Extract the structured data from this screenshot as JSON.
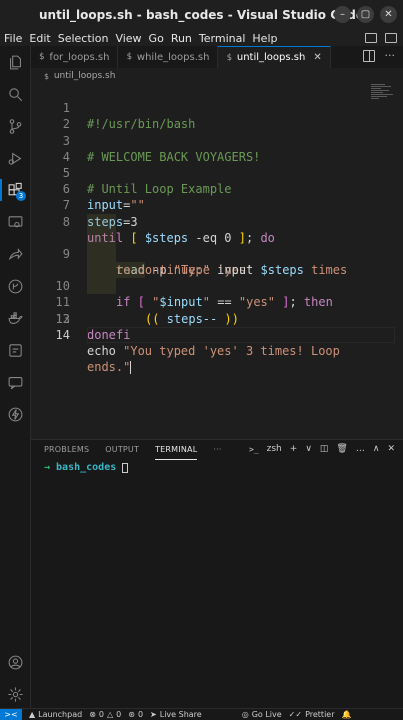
{
  "window": {
    "title": "until_loops.sh - bash_codes - Visual Studio Code",
    "controls": [
      "–",
      "▢",
      "✕"
    ]
  },
  "menu": [
    "File",
    "Edit",
    "Selection",
    "View",
    "Go",
    "Run",
    "Terminal",
    "Help"
  ],
  "activity": {
    "extensions_badge": "3"
  },
  "tabs": [
    {
      "label": "for_loops.sh",
      "icon": "$"
    },
    {
      "label": "while_loops.sh",
      "icon": "$"
    },
    {
      "label": "until_loops.sh",
      "icon": "$",
      "close": "✕"
    }
  ],
  "breadcrumb": {
    "icon": "$",
    "file": "until_loops.sh"
  },
  "editor": {
    "lines": [
      {
        "n": "1"
      },
      {
        "n": "2"
      },
      {
        "n": "3"
      },
      {
        "n": "4"
      },
      {
        "n": "5"
      },
      {
        "n": "6"
      },
      {
        "n": "7"
      },
      {
        "n": "8"
      },
      {
        "n": "9"
      },
      {
        "n": "10"
      },
      {
        "n": "11"
      },
      {
        "n": "12"
      },
      {
        "n": "13"
      },
      {
        "n": "14"
      }
    ],
    "t": {
      "l1": "#!/usr/bin/bash",
      "l3": "# WELCOME BACK VOYAGERS!",
      "l5": "# Until Loop Example",
      "l6_var": "input",
      "l6_eq": "=",
      "l6_str": "\"\"",
      "l7_var": "steps",
      "l7_eq": "=",
      "l7_num": "3",
      "l8_kw": "until",
      "l8_b1": " [ ",
      "l8_var": "$steps",
      "l8_op": " -eq 0 ",
      "l8_b2": "]",
      "l8_semi": "; ",
      "l8_do": "do",
      "l9_cmd": "read",
      "l9_flag": " -p ",
      "l9_str": "\"Type 'yes' ",
      "l9_var": "$steps",
      "l9_str2": " times",
      "l9b_str": "to continue:\"",
      "l9b_rest": " input",
      "l10_kw": "if",
      "l10_b1": " [ ",
      "l10_str1": "\"",
      "l10_var": "$input",
      "l10_str2": "\"",
      "l10_op": " == ",
      "l10_str3": "\"yes\"",
      "l10_b2": " ]",
      "l10_semi": "; ",
      "l10_then": "then",
      "l11_p1": "((",
      "l11_body": " steps-- ",
      "l11_p2": "))",
      "l12_kw": "fi",
      "l13_kw": "done",
      "l14_cmd": "echo",
      "l14_str": " \"You typed 'yes' 3 times! Loop",
      "l14b_str": "ends.\""
    }
  },
  "panel": {
    "tabs": [
      "PROBLEMS",
      "OUTPUT",
      "TERMINAL",
      "···"
    ],
    "shell": "zsh",
    "actions": [
      "+",
      "∨",
      "◫",
      "…",
      "∧",
      "✕"
    ],
    "prompt_arrow": "→",
    "dir": "bash_codes"
  },
  "status": {
    "remote": "><",
    "launchpad": "Launchpad",
    "errors": "0",
    "warnings": "0",
    "ports": "0",
    "liveshare": "Live Share",
    "golive": "Go Live",
    "prettier": "Prettier"
  },
  "colors": {
    "accent": "#0078d4",
    "comment": "#6a9955",
    "keyword": "#c586c0",
    "string": "#ce9178",
    "variable": "#9cdcfe"
  }
}
